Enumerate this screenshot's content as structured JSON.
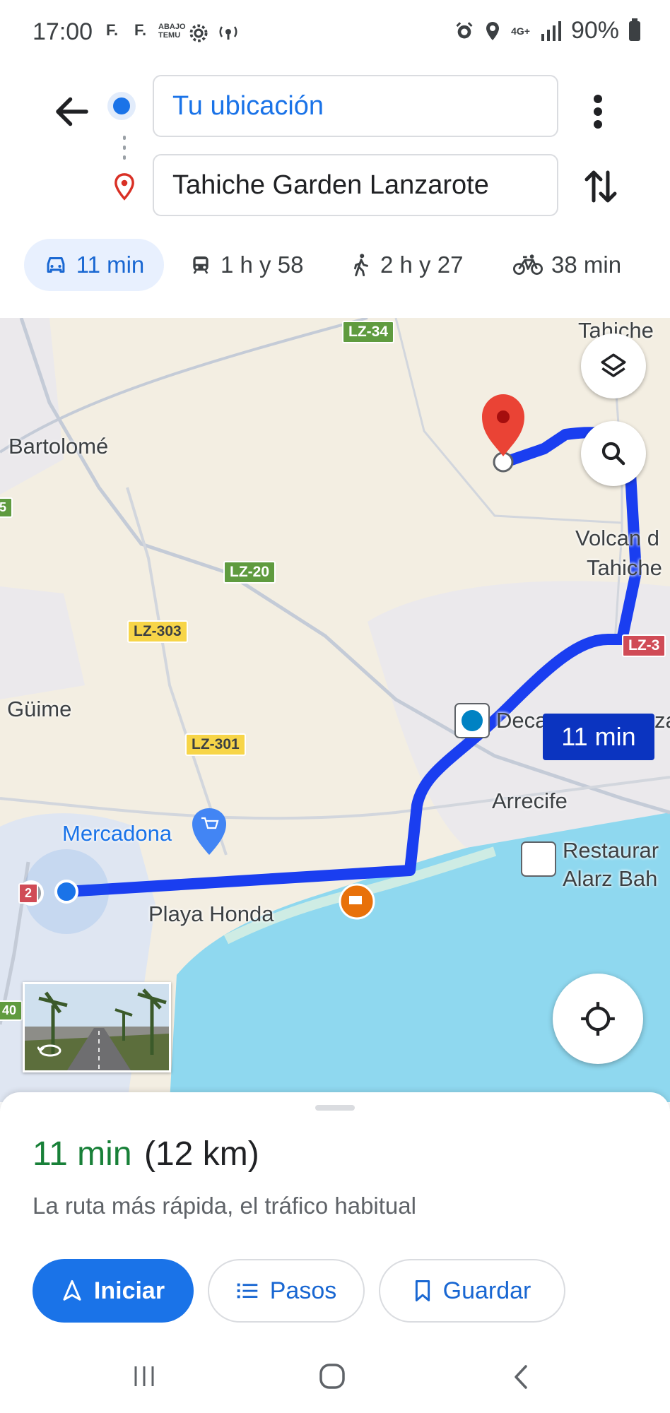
{
  "status_bar": {
    "time": "17:00",
    "left_icons": [
      "F.",
      "F.",
      "ABAJO TEMU",
      "gear-icon",
      "nfc-icon"
    ],
    "network": "4G+",
    "battery": "90%"
  },
  "header": {
    "origin_value": "Tu ubicación",
    "destination_value": "Tahiche Garden Lanzarote",
    "modes": [
      {
        "name": "car",
        "label": "11 min",
        "selected": true
      },
      {
        "name": "transit",
        "label": "1 h y 58",
        "selected": false
      },
      {
        "name": "walk",
        "label": "2 h y 27",
        "selected": false
      },
      {
        "name": "bike",
        "label": "38 min",
        "selected": false
      }
    ]
  },
  "map": {
    "places": {
      "tahiche_top": "Tahiche",
      "bartolome": "Bartolomé",
      "volcan": "Volcan d",
      "volcan2": "Tahiche",
      "guime": "Güime",
      "decathlon": "Deca",
      "decathlon_end": "za",
      "arrecife": "Arrecife",
      "mercadona": "Mercadona",
      "playa_honda": "Playa Honda",
      "restaurant1": "Restaurar",
      "restaurant2": "Alarz Bah"
    },
    "road_labels": {
      "lz34": "LZ-34",
      "lz20": "LZ-20",
      "lz303": "LZ-303",
      "lz301": "LZ-301",
      "lz3": "LZ-3",
      "lz2": "2",
      "r40": "40",
      "r5": "5"
    },
    "duration_bubble": "11 min",
    "route_color": "#1a3ef0"
  },
  "sheet": {
    "time": "11 min",
    "distance": "(12 km)",
    "description": "La ruta más rápida, el tráfico habitual",
    "start_label": "Iniciar",
    "steps_label": "Pasos",
    "save_label": "Guardar"
  },
  "colors": {
    "accent": "#1a73e8",
    "time_green": "#188038",
    "water": "#8fd8ef",
    "land": "#f3eee2"
  }
}
